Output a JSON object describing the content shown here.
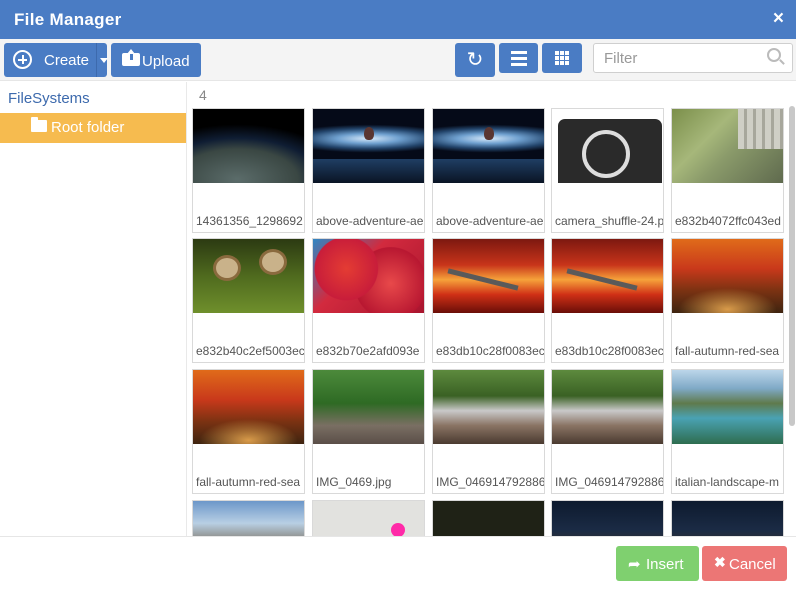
{
  "window": {
    "title": "File Manager",
    "close_glyph": "×"
  },
  "toolbar": {
    "create_label": "Create",
    "upload_label": "Upload",
    "refresh_glyph": "↻",
    "filter_placeholder": "Filter",
    "icons": [
      "plus-circle-icon",
      "caret-down-icon",
      "upload-icon",
      "refresh-icon",
      "list-view-icon",
      "grid-view-icon",
      "search-icon"
    ]
  },
  "sidebar": {
    "heading": "FileSystems",
    "selected_folder": "Root folder"
  },
  "content": {
    "item_count": "4",
    "files": [
      {
        "name": "14361356_1298692",
        "thumb": "t-earth"
      },
      {
        "name": "above-adventure-ae",
        "thumb": "t-balloon"
      },
      {
        "name": "above-adventure-ae",
        "thumb": "t-balloon"
      },
      {
        "name": "camera_shuffle-24.p",
        "thumb": "t-camera"
      },
      {
        "name": "e832b4072ffc043ed",
        "thumb": "t-frog"
      },
      {
        "name": "e832b40c2ef5003ec",
        "thumb": "t-snails"
      },
      {
        "name": "e832b70e2afd093e",
        "thumb": "t-redleaves"
      },
      {
        "name": "e83db10c28f0083ec",
        "thumb": "t-apple"
      },
      {
        "name": "e83db10c28f0083ec",
        "thumb": "t-apple"
      },
      {
        "name": "fall-autumn-red-sea",
        "thumb": "t-autumn"
      },
      {
        "name": "fall-autumn-red-sea",
        "thumb": "t-autumn"
      },
      {
        "name": "IMG_0469.jpg",
        "thumb": "t-pinetree"
      },
      {
        "name": "IMG_046914792886",
        "thumb": "t-house"
      },
      {
        "name": "IMG_046914792886",
        "thumb": "t-house"
      },
      {
        "name": "italian-landscape-m",
        "thumb": "t-lake"
      },
      {
        "name": "",
        "thumb": "t-mountain"
      },
      {
        "name": "",
        "thumb": "t-pink"
      },
      {
        "name": "",
        "thumb": "t-dark"
      },
      {
        "name": "",
        "thumb": "t-city"
      },
      {
        "name": "",
        "thumb": "t-city"
      }
    ]
  },
  "footer": {
    "insert_label": "Insert",
    "insert_glyph": "➦",
    "cancel_label": "Cancel",
    "cancel_glyph": "✖"
  },
  "colors": {
    "primary": "#4a7cc4",
    "folder_highlight": "#f6bb4f",
    "insert": "#7fd06f",
    "cancel": "#ec7675"
  }
}
